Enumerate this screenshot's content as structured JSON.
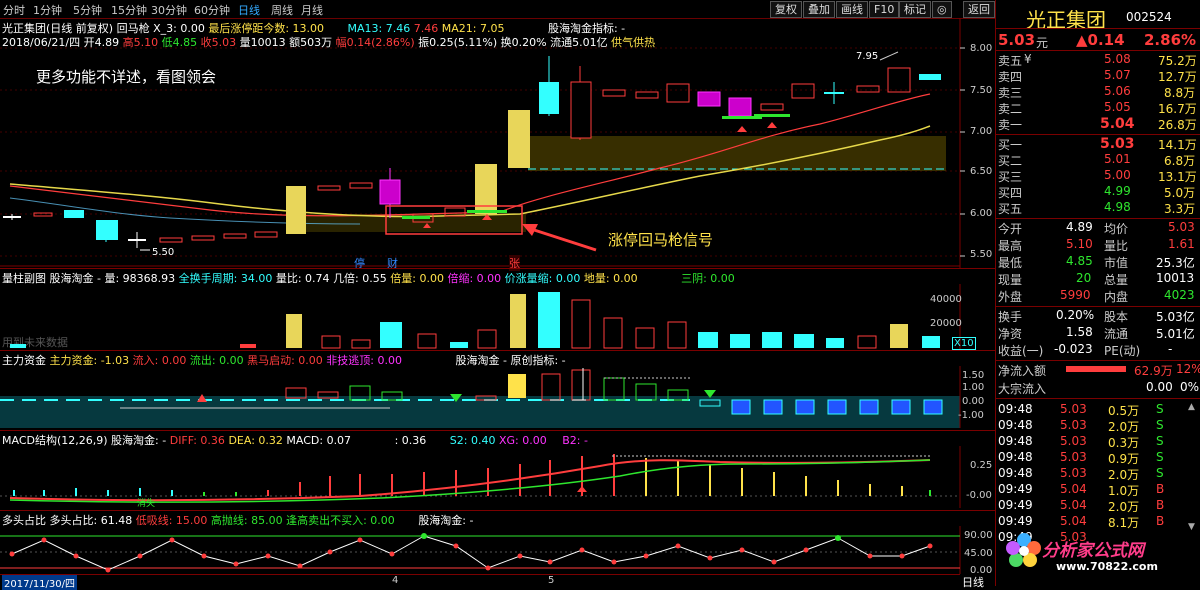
{
  "toolbar": {
    "periods": [
      "分时",
      "1分钟",
      "5分钟",
      "15分钟",
      "30分钟",
      "60分钟",
      "日线",
      "周线",
      "月线"
    ],
    "active_period": "日线",
    "period_extra": "更多>>",
    "right_buttons": [
      "复权",
      "叠加",
      "画线",
      "F10",
      "标记",
      "◎",
      "返回"
    ]
  },
  "main": {
    "info1": {
      "name": "光正集团(日线 前复权)",
      "indicator": "回马枪 X_3: 0.00",
      "recent": "最后涨停距今数: 13.00",
      "ma13": "MA13: 7.46",
      "ma13_v": "7.46",
      "ma21": "MA21: 7.05",
      "indicator2": "股海淘金指标: -"
    },
    "info2": {
      "date": "2018/06/21/四",
      "open": "开4.89",
      "high": "高5.10",
      "low": "低4.85",
      "close": "收5.03",
      "vol": "量10013",
      "amt": "额503万",
      "chg": "幅0.14(2.86%)",
      "amp": "振0.25(5.11%)",
      "turn": "换0.20%",
      "float": "流通5.01亿",
      "hot": "供气供热"
    },
    "note": "更多功能不详述，看图领会",
    "signal_text": "涨停回马枪信号",
    "low_label": "5.50",
    "high_label": "7.95",
    "markers": [
      "停",
      "财",
      "张"
    ],
    "y_ticks": [
      "8.00",
      "7.50",
      "7.00",
      "6.50",
      "6.00",
      "5.50"
    ]
  },
  "vol_panel": {
    "title": "量柱副图",
    "brand": "股海淘金 - 量: 98368.93",
    "period": "全换手周期: 34.00",
    "ratio": "量比: 0.74",
    "factor": "几倍: 0.55",
    "times": "倍量: 0.00",
    "shrink": "倍缩: 0.00",
    "price_up": "价涨量缩: 0.00",
    "low": "地量: 0.00",
    "three": "三阴: 0.00",
    "faded": "用到未来数据",
    "y_ticks": [
      "40000",
      "20000"
    ],
    "unit": "X10"
  },
  "fund_panel": {
    "title": "主力资金",
    "main_fund": "主力资金: -1.03",
    "inflow": "流入: 0.00",
    "outflow": "流出: 0.00",
    "start": "黑马启动: 0.00",
    "escape": "非技逃顶: 0.00",
    "indicator": "股海淘金 - 原创指标: -",
    "y_ticks": [
      "1.50",
      "1.00",
      "0.00",
      "-1.00"
    ]
  },
  "macd_panel": {
    "title": "MACD结构(12,26,9)",
    "brand": "股海淘金: -",
    "diff": "DIFF: 0.36",
    "dea": "DEA: 0.32",
    "macd": "MACD: 0.07",
    "v2": ": 0.36",
    "s2": "S2: 0.40",
    "xg": "XG: 0.00",
    "b2": "B2: -",
    "y_ticks": [
      "0.25",
      "-0.00"
    ],
    "tag": "消失"
  },
  "ratio_panel": {
    "title": "多头占比",
    "ratio": "多头占比: 61.48",
    "low_line": "低吸线: 15.00",
    "high_line": "高抛线: 85.00",
    "warning": "逢高卖出不买入: 0.00",
    "brand": "股海淘金: -",
    "y_ticks": [
      "90.00",
      "45.00",
      "0.00"
    ]
  },
  "bottom": {
    "date": "2017/11/30/四",
    "marks": [
      "4",
      "5"
    ],
    "period": "日线"
  },
  "quote": {
    "name": "光正集团",
    "code": "002524",
    "price": "5.03",
    "unit": "元",
    "change": "▲0.14",
    "pct": "2.86%",
    "asks": [
      {
        "label": "卖五",
        "sym": "¥",
        "price": "5.08",
        "vol": "75.2万"
      },
      {
        "label": "卖四",
        "sym": "",
        "price": "5.07",
        "vol": "12.7万"
      },
      {
        "label": "卖三",
        "sym": "",
        "price": "5.06",
        "vol": "8.8万"
      },
      {
        "label": "卖二",
        "sym": "",
        "price": "5.05",
        "vol": "16.7万"
      },
      {
        "label": "卖一",
        "sym": "",
        "price": "5.04",
        "vol": "26.8万"
      }
    ],
    "bids": [
      {
        "label": "买一",
        "price": "5.03",
        "vol": "14.1万"
      },
      {
        "label": "买二",
        "price": "5.01",
        "vol": "6.8万"
      },
      {
        "label": "买三",
        "price": "5.00",
        "vol": "13.1万"
      },
      {
        "label": "买四",
        "price": "4.99",
        "vol": "5.0万"
      },
      {
        "label": "买五",
        "price": "4.98",
        "vol": "3.3万"
      }
    ],
    "stats": [
      {
        "k1": "今开",
        "v1": "4.89",
        "k2": "均价",
        "v2": "5.03",
        "c1": "white",
        "c2": "red"
      },
      {
        "k1": "最高",
        "v1": "5.10",
        "k2": "量比",
        "v2": "1.61",
        "c1": "red",
        "c2": "red"
      },
      {
        "k1": "最低",
        "v1": "4.85",
        "k2": "市值",
        "v2": "25.3亿",
        "c1": "green",
        "c2": "white"
      },
      {
        "k1": "现量",
        "v1": "20",
        "k2": "总量",
        "v2": "10013",
        "c1": "green",
        "c2": "white"
      },
      {
        "k1": "外盘",
        "v1": "5990",
        "k2": "内盘",
        "v2": "4023",
        "c1": "red",
        "c2": "green"
      },
      {
        "k1": "换手",
        "v1": "0.20%",
        "k2": "股本",
        "v2": "5.03亿",
        "c1": "white",
        "c2": "white"
      },
      {
        "k1": "净资",
        "v1": "1.58",
        "k2": "流通",
        "v2": "5.01亿",
        "c1": "white",
        "c2": "white"
      },
      {
        "k1": "收益(一)",
        "v1": "-0.023",
        "k2": "PE(动)",
        "v2": "-",
        "c1": "white",
        "c2": "white"
      }
    ],
    "net_inflow_label": "净流入额",
    "net_inflow_val": "62.9万",
    "net_inflow_pct": "12%",
    "block_label": "大宗流入",
    "block_val": "0.00",
    "block_pct": "0%",
    "ticks": [
      {
        "t": "09:48",
        "p": "5.03",
        "v": "0.5万",
        "s": "S"
      },
      {
        "t": "09:48",
        "p": "5.03",
        "v": "2.0万",
        "s": "S"
      },
      {
        "t": "09:48",
        "p": "5.03",
        "v": "0.3万",
        "s": "S"
      },
      {
        "t": "09:48",
        "p": "5.03",
        "v": "0.9万",
        "s": "S"
      },
      {
        "t": "09:48",
        "p": "5.03",
        "v": "2.0万",
        "s": "S"
      },
      {
        "t": "09:49",
        "p": "5.04",
        "v": "1.0万",
        "s": "B"
      },
      {
        "t": "09:49",
        "p": "5.04",
        "v": "2.0万",
        "s": "B"
      },
      {
        "t": "09:49",
        "p": "5.04",
        "v": "8.1万",
        "s": "B"
      },
      {
        "t": "09:49",
        "p": "5.03",
        "v": "",
        "s": ""
      }
    ]
  },
  "watermark": {
    "title": "分析家公式网",
    "url": "www.70822.com"
  },
  "colors": {
    "up": "#ff3d3d",
    "down": "#2ee62e",
    "grid": "#7a0000",
    "bg": "#000000"
  }
}
